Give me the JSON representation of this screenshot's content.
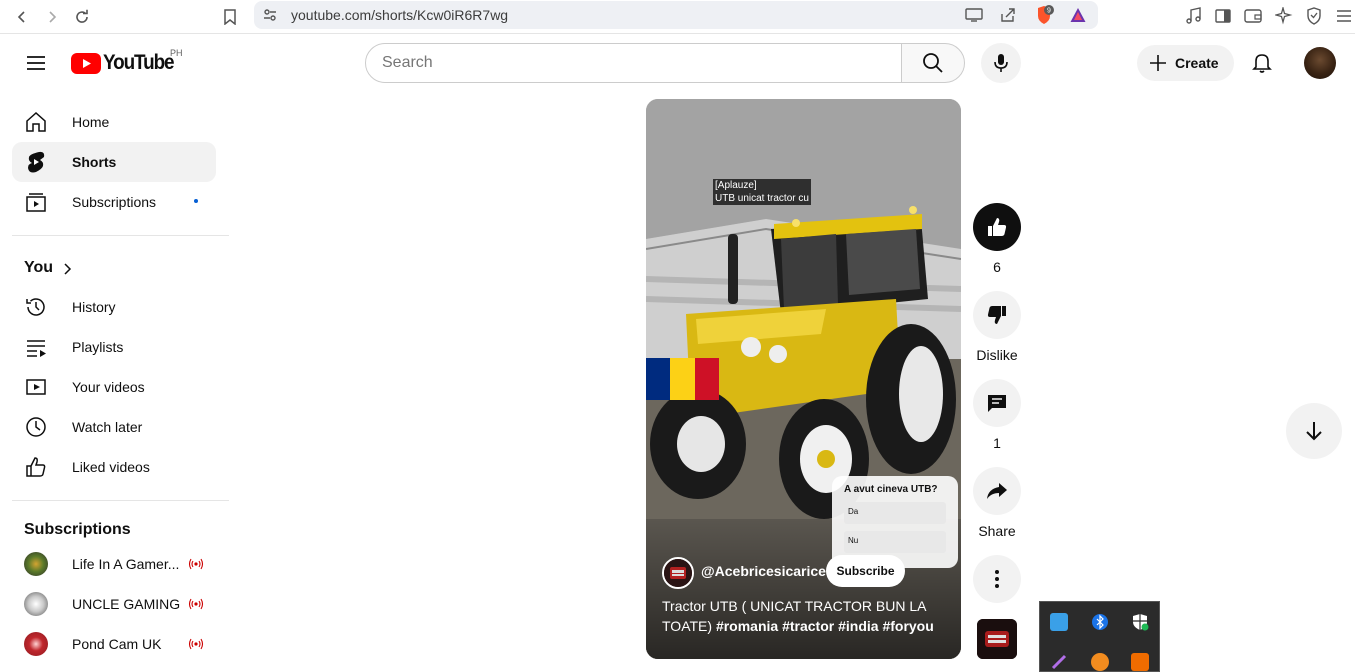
{
  "browser": {
    "url": "youtube.com/shorts/Kcw0iR6R7wg",
    "brave_badge": "9"
  },
  "masthead": {
    "logo_text": "YouTube",
    "country_code": "PH",
    "search_placeholder": "Search",
    "create_label": "Create"
  },
  "sidebar": {
    "main": [
      {
        "label": "Home",
        "icon": "home-icon"
      },
      {
        "label": "Shorts",
        "icon": "shorts-icon"
      },
      {
        "label": "Subscriptions",
        "icon": "subscriptions-icon"
      }
    ],
    "you_heading": "You",
    "you_items": [
      {
        "label": "History",
        "icon": "history-icon"
      },
      {
        "label": "Playlists",
        "icon": "playlists-icon"
      },
      {
        "label": "Your videos",
        "icon": "your-videos-icon"
      },
      {
        "label": "Watch later",
        "icon": "watch-later-icon"
      },
      {
        "label": "Liked videos",
        "icon": "liked-videos-icon"
      }
    ],
    "subscriptions_heading": "Subscriptions",
    "subscriptions": [
      {
        "label": "Life In A Gamer...",
        "avatar_color": "#5b7a2a"
      },
      {
        "label": "UNCLE GAMING",
        "avatar_color": "#c9c9c9"
      },
      {
        "label": "Pond Cam UK",
        "avatar_color": "#c0272d"
      }
    ]
  },
  "short": {
    "caption_line1": "[Aplauze]",
    "caption_line2": "UTB unicat tractor cu",
    "poll": {
      "question": "A avut cineva UTB?",
      "options": [
        "Da",
        "Nu"
      ]
    },
    "channel": "@Acebricesicarice",
    "subscribe_label": "Subscribe",
    "title_text": "Tractor UTB ( UNICAT TRACTOR BUN LA TOATE) ",
    "title_tags": "#romania #tractor #india #foryou",
    "flag_colors": [
      "#002b7f",
      "#fcd116",
      "#ce1126"
    ]
  },
  "actions": {
    "like_count": "6",
    "dislike_label": "Dislike",
    "comment_count": "1",
    "share_label": "Share"
  },
  "colors": {
    "brand_red": "#ff0000",
    "accent_blue": "#065fd4",
    "live_red": "#cc0000"
  }
}
